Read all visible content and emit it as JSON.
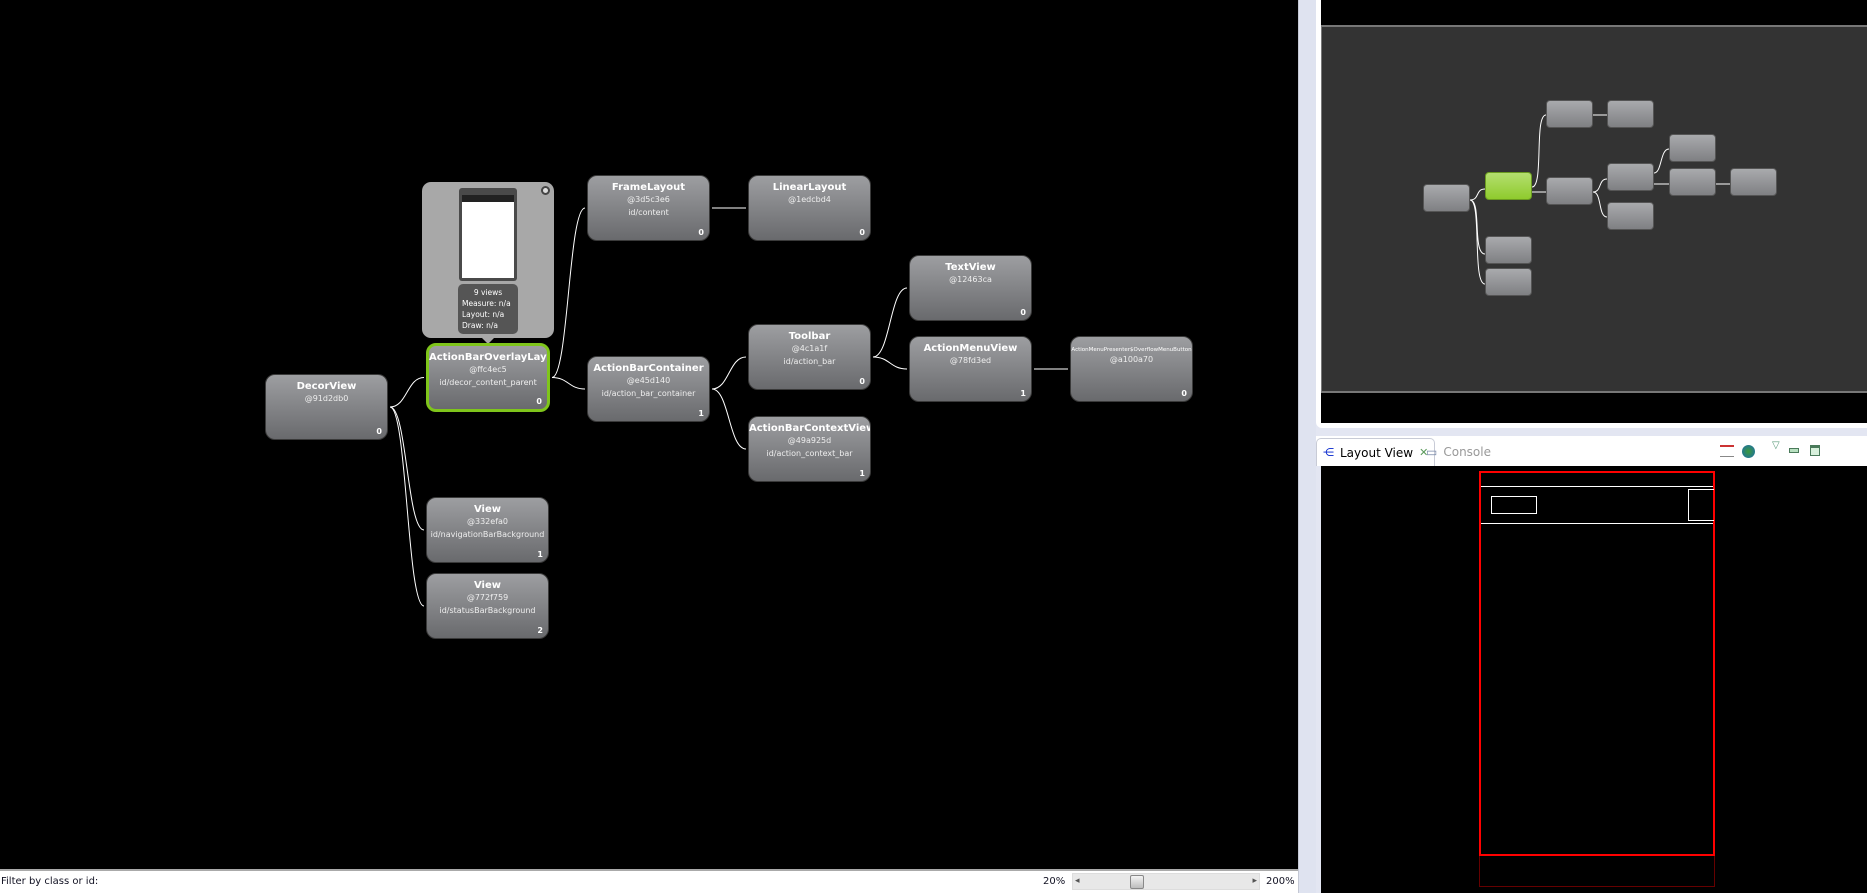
{
  "tree": {
    "nodes": [
      {
        "key": "decor",
        "name": "DecorView",
        "hash": "@91d2db0",
        "id": "",
        "index": "0"
      },
      {
        "key": "overlay",
        "name": "ActionBarOverlayLayout",
        "hash": "@ffc4ec5",
        "id": "id/decor_content_parent",
        "index": "0",
        "selected": true
      },
      {
        "key": "frame",
        "name": "FrameLayout",
        "hash": "@3d5c3e6",
        "id": "id/content",
        "index": "0"
      },
      {
        "key": "linear",
        "name": "LinearLayout",
        "hash": "@1edcbd4",
        "id": "",
        "index": "0"
      },
      {
        "key": "abc",
        "name": "ActionBarContainer",
        "hash": "@e45d140",
        "id": "id/action_bar_container",
        "index": "1"
      },
      {
        "key": "toolbar",
        "name": "Toolbar",
        "hash": "@4c1a1f",
        "id": "id/action_bar",
        "index": "0"
      },
      {
        "key": "abctx",
        "name": "ActionBarContextView",
        "hash": "@49a925d",
        "id": "id/action_context_bar",
        "index": "1"
      },
      {
        "key": "textview",
        "name": "TextView",
        "hash": "@12463ca",
        "id": "",
        "index": "0"
      },
      {
        "key": "amv",
        "name": "ActionMenuView",
        "hash": "@78fd3ed",
        "id": "",
        "index": "1"
      },
      {
        "key": "overflow",
        "name": "ActionMenuPresenter$OverflowMenuButton",
        "hash": "@a100a70",
        "id": "",
        "index": "0"
      },
      {
        "key": "navbg",
        "name": "View",
        "hash": "@332efa0",
        "id": "id/navigationBarBackground",
        "index": "1"
      },
      {
        "key": "statusbg",
        "name": "View",
        "hash": "@772f759",
        "id": "id/statusBarBackground",
        "index": "2"
      }
    ],
    "tooltip": {
      "views": "9 views",
      "measure": "Measure: n/a",
      "layout": "Layout: n/a",
      "draw": "Draw: n/a"
    }
  },
  "status_bar": {
    "filter_label": "Filter by class or id:",
    "zoom_min": "20%",
    "zoom_max": "200%",
    "zoom_level": 0.3
  },
  "tabs": [
    {
      "label": "Layout View",
      "icon": "tree-icon",
      "active": true
    },
    {
      "label": "Console",
      "icon": "console-icon",
      "active": false
    }
  ],
  "colors": {
    "selected": "#7fc51b",
    "layout_bounds": "#ff0000"
  }
}
